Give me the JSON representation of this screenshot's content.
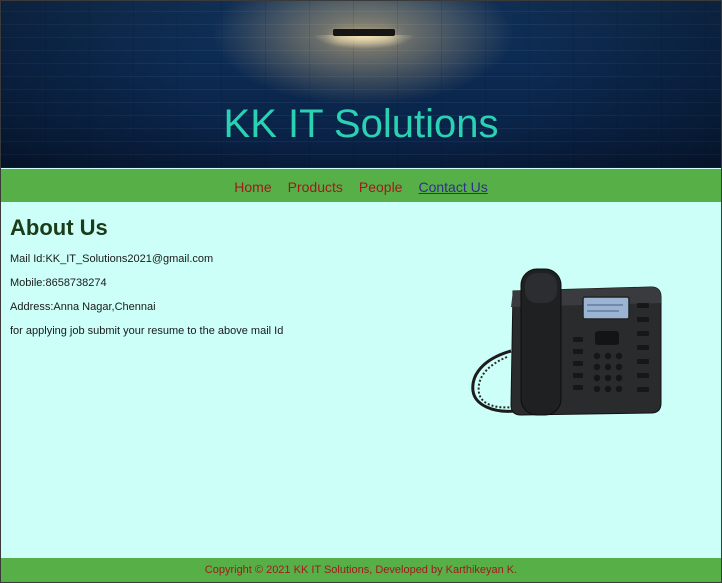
{
  "header": {
    "title": "KK IT Solutions"
  },
  "nav": {
    "items": [
      {
        "label": "Home"
      },
      {
        "label": "Products"
      },
      {
        "label": "People"
      },
      {
        "label": "Contact Us"
      }
    ],
    "active_item": "Contact Us"
  },
  "about": {
    "heading": "About Us",
    "mail": "Mail Id:KK_IT_Solutions2021@gmail.com",
    "mobile": "Mobile:8658738274",
    "address": "Address:Anna Nagar,Chennai",
    "note": "for applying job submit your resume to the above mail Id"
  },
  "image": {
    "subject": "desk-phone"
  },
  "footer": {
    "copyright": "Copyright © 2021 KK IT Solutions, Developed by Karthikeyan K."
  },
  "colors": {
    "title": "#2ad1b3",
    "nav_bar": "#56b047",
    "nav_link": "#a3191b",
    "nav_active": "#2f2f8f",
    "content_bg": "#ccfff8",
    "heading": "#1b3b1b"
  }
}
